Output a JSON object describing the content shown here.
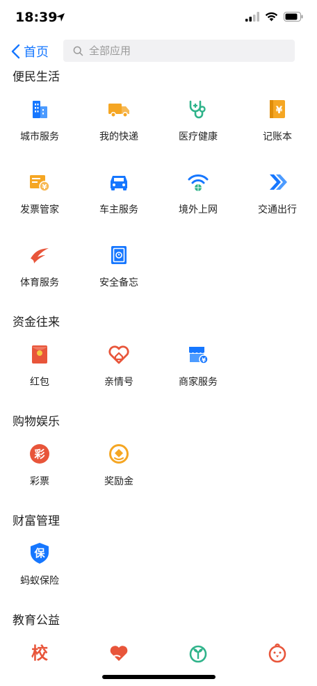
{
  "status_bar": {
    "time": "18:39"
  },
  "nav": {
    "back_label": "首页",
    "search_placeholder": "全部应用"
  },
  "sections": [
    {
      "title": "便民生活",
      "apps": [
        {
          "label": "城市服务",
          "icon": "city-buildings-icon"
        },
        {
          "label": "我的快递",
          "icon": "delivery-truck-icon"
        },
        {
          "label": "医疗健康",
          "icon": "stethoscope-icon"
        },
        {
          "label": "记账本",
          "icon": "ledger-book-icon"
        },
        {
          "label": "发票管家",
          "icon": "invoice-icon"
        },
        {
          "label": "车主服务",
          "icon": "car-icon"
        },
        {
          "label": "境外上网",
          "icon": "wifi-globe-icon"
        },
        {
          "label": "交通出行",
          "icon": "double-chevron-icon"
        },
        {
          "label": "体育服务",
          "icon": "sports-swoosh-icon"
        },
        {
          "label": "安全备忘",
          "icon": "safe-box-icon"
        }
      ]
    },
    {
      "title": "资金往来",
      "apps": [
        {
          "label": "红包",
          "icon": "red-envelope-icon"
        },
        {
          "label": "亲情号",
          "icon": "heart-home-icon"
        },
        {
          "label": "商家服务",
          "icon": "store-icon"
        }
      ]
    },
    {
      "title": "购物娱乐",
      "apps": [
        {
          "label": "彩票",
          "icon": "lottery-icon",
          "glyph": "彩"
        },
        {
          "label": "奖励金",
          "icon": "reward-coin-icon"
        }
      ]
    },
    {
      "title": "财富管理",
      "apps": [
        {
          "label": "蚂蚁保险",
          "icon": "insurance-shield-icon",
          "glyph": "保"
        }
      ]
    },
    {
      "title": "教育公益",
      "apps": [
        {
          "label": "",
          "icon": "school-icon",
          "glyph": "校"
        },
        {
          "label": "",
          "icon": "charity-heart-icon"
        },
        {
          "label": "",
          "icon": "sprout-icon"
        },
        {
          "label": "",
          "icon": "chick-icon"
        }
      ]
    }
  ],
  "colors": {
    "blue": "#1677ff",
    "orange": "#f5a623",
    "green": "#2fb38a",
    "red": "#e8553a"
  }
}
